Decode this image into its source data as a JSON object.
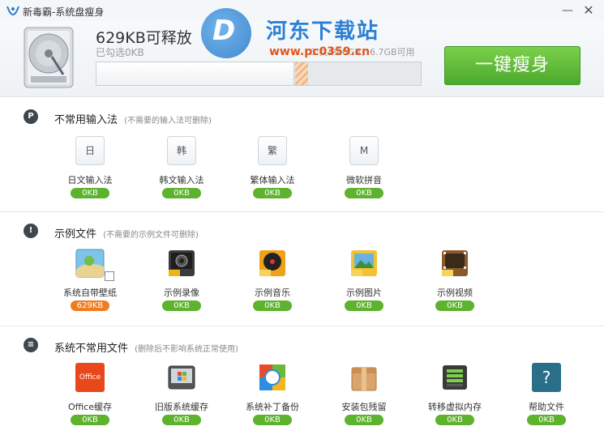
{
  "window": {
    "title": "新毒霸-系统盘瘦身",
    "minimize_glyph": "—",
    "close_glyph": "✕"
  },
  "header": {
    "free_space": "629KB可释放",
    "selected": "已勾选0KB",
    "disk_info": "C:共49.6GB，6.7GB可用",
    "progress_used_fraction": 0.61,
    "slim_button": "一键瘦身"
  },
  "watermark": {
    "title": "河东下载站",
    "url": "www.pc0359.cn"
  },
  "sections": [
    {
      "title": "不常用输入法",
      "note": "(不需要的输入法可删除)",
      "icon": "P",
      "items": [
        {
          "key": "日",
          "label": "日文输入法",
          "size": "0KB"
        },
        {
          "key": "韩",
          "label": "韩文输入法",
          "size": "0KB"
        },
        {
          "key": "繁",
          "label": "繁体输入法",
          "size": "0KB"
        },
        {
          "key": "M",
          "label": "微软拼音",
          "size": "0KB"
        }
      ]
    },
    {
      "title": "示例文件",
      "note": "(不需要的示例文件可删除)",
      "icon": "!",
      "items": [
        {
          "label": "系统自带壁纸",
          "size": "629KB",
          "icon": "wallpaper-icon"
        },
        {
          "label": "示例录像",
          "size": "0KB",
          "icon": "video-recording-icon"
        },
        {
          "label": "示例音乐",
          "size": "0KB",
          "icon": "music-icon"
        },
        {
          "label": "示例图片",
          "size": "0KB",
          "icon": "pictures-icon"
        },
        {
          "label": "示例视频",
          "size": "0KB",
          "icon": "video-icon"
        }
      ]
    },
    {
      "title": "系统不常用文件",
      "note": "(删除后不影响系统正常使用)",
      "icon": "≡",
      "items": [
        {
          "label": "Office缓存",
          "size": "0KB",
          "icon": "office-icon",
          "icon_text": "Office"
        },
        {
          "label": "旧版系统缓存",
          "size": "0KB",
          "icon": "old-system-icon"
        },
        {
          "label": "系统补丁备份",
          "size": "0KB",
          "icon": "patch-backup-icon"
        },
        {
          "label": "安装包残留",
          "size": "0KB",
          "icon": "package-icon"
        },
        {
          "label": "转移虚拟内存",
          "size": "0KB",
          "icon": "memory-chip-icon"
        },
        {
          "label": "帮助文件",
          "size": "0KB",
          "icon": "help-icon",
          "icon_text": "?"
        }
      ]
    }
  ],
  "colors": {
    "accent_green": "#5db22e",
    "badge_orange": "#ef7d22",
    "watermark_blue": "#2a7fd4",
    "watermark_orange": "#e0561c"
  }
}
